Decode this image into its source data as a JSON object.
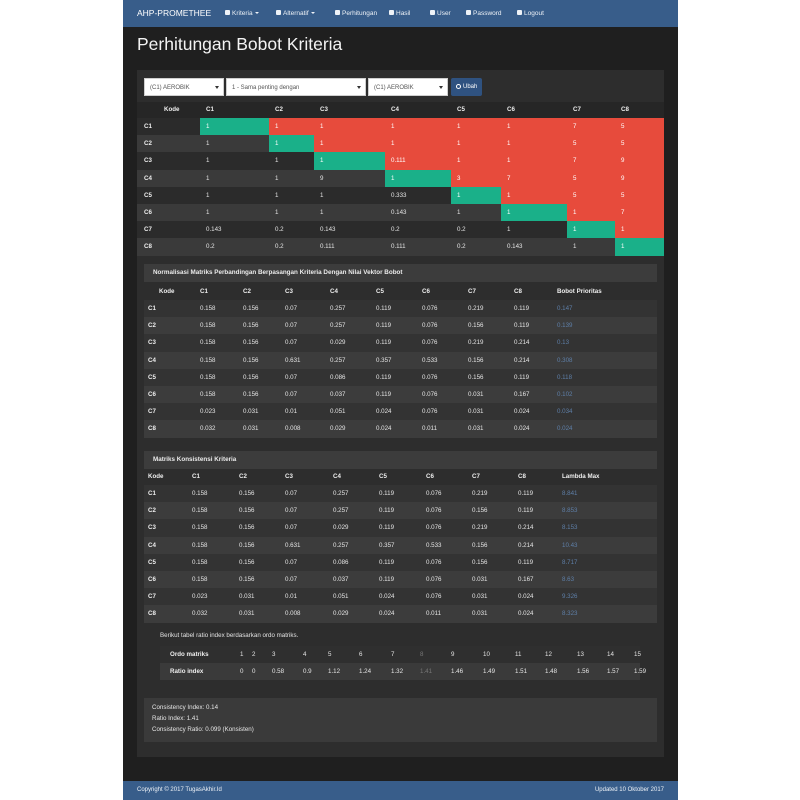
{
  "navbar": {
    "brand": "AHP-PROMETHEE",
    "items": [
      {
        "label": "Kriteria",
        "icon": "grid-icon",
        "dropdown": true
      },
      {
        "label": "Alternatif",
        "icon": "user-icon",
        "dropdown": true
      },
      {
        "label": "Perhitungan",
        "icon": "list-icon",
        "dropdown": false
      },
      {
        "label": "Hasil",
        "icon": "bar-chart-icon",
        "dropdown": false
      },
      {
        "label": "User",
        "icon": "user-icon",
        "dropdown": false
      },
      {
        "label": "Password",
        "icon": "lock-icon",
        "dropdown": false
      },
      {
        "label": "Logout",
        "icon": "logout-icon",
        "dropdown": false
      }
    ]
  },
  "page": {
    "title": "Perhitungan Bobot Kriteria"
  },
  "form": {
    "select1": "(C1) AEROBIK",
    "select2": "1 - Sama penting dengan",
    "select3": "(C1) AEROBIK",
    "submit": "Ubah"
  },
  "colors": {
    "green": "#1ab089",
    "red": "#e74b3c",
    "navbar": "#385d8a",
    "link_blue": "#5e7fa8"
  },
  "comparison": {
    "headers": [
      "Kode",
      "C1",
      "C2",
      "C3",
      "C4",
      "C5",
      "C6",
      "C7",
      "C8"
    ],
    "rows": [
      [
        "C1",
        "1",
        "1",
        "1",
        "1",
        "1",
        "1",
        "7",
        "5"
      ],
      [
        "C2",
        "1",
        "1",
        "1",
        "1",
        "1",
        "1",
        "5",
        "5"
      ],
      [
        "C3",
        "1",
        "1",
        "1",
        "0.111",
        "1",
        "1",
        "7",
        "9"
      ],
      [
        "C4",
        "1",
        "1",
        "9",
        "1",
        "3",
        "7",
        "5",
        "9"
      ],
      [
        "C5",
        "1",
        "1",
        "1",
        "0.333",
        "1",
        "1",
        "5",
        "5"
      ],
      [
        "C6",
        "1",
        "1",
        "1",
        "0.143",
        "1",
        "1",
        "1",
        "7"
      ],
      [
        "C7",
        "0.143",
        "0.2",
        "0.143",
        "0.2",
        "0.2",
        "1",
        "1",
        "1"
      ],
      [
        "C8",
        "0.2",
        "0.2",
        "0.111",
        "0.111",
        "0.2",
        "0.143",
        "1",
        "1"
      ]
    ]
  },
  "normalization": {
    "title": "Normalisasi Matriks Perbandingan Berpasangan Kriteria Dengan Nilai Vektor Bobot",
    "headers": [
      "Kode",
      "C1",
      "C2",
      "C3",
      "C4",
      "C5",
      "C6",
      "C7",
      "C8",
      "Bobot Prioritas"
    ],
    "rows": [
      [
        "C1",
        "0.158",
        "0.156",
        "0.07",
        "0.257",
        "0.119",
        "0.076",
        "0.219",
        "0.119",
        "0.147"
      ],
      [
        "C2",
        "0.158",
        "0.156",
        "0.07",
        "0.257",
        "0.119",
        "0.076",
        "0.156",
        "0.119",
        "0.139"
      ],
      [
        "C3",
        "0.158",
        "0.156",
        "0.07",
        "0.029",
        "0.119",
        "0.076",
        "0.219",
        "0.214",
        "0.13"
      ],
      [
        "C4",
        "0.158",
        "0.156",
        "0.631",
        "0.257",
        "0.357",
        "0.533",
        "0.156",
        "0.214",
        "0.308"
      ],
      [
        "C5",
        "0.158",
        "0.156",
        "0.07",
        "0.086",
        "0.119",
        "0.076",
        "0.156",
        "0.119",
        "0.118"
      ],
      [
        "C6",
        "0.158",
        "0.156",
        "0.07",
        "0.037",
        "0.119",
        "0.076",
        "0.031",
        "0.167",
        "0.102"
      ],
      [
        "C7",
        "0.023",
        "0.031",
        "0.01",
        "0.051",
        "0.024",
        "0.076",
        "0.031",
        "0.024",
        "0.034"
      ],
      [
        "C8",
        "0.032",
        "0.031",
        "0.008",
        "0.029",
        "0.024",
        "0.011",
        "0.031",
        "0.024",
        "0.024"
      ]
    ]
  },
  "consistency": {
    "title": "Matriks Konsistensi Kriteria",
    "headers": [
      "Kode",
      "C1",
      "C2",
      "C3",
      "C4",
      "C5",
      "C6",
      "C7",
      "C8",
      "Lambda Max"
    ],
    "rows": [
      [
        "C1",
        "0.158",
        "0.156",
        "0.07",
        "0.257",
        "0.119",
        "0.076",
        "0.219",
        "0.119",
        "8.841"
      ],
      [
        "C2",
        "0.158",
        "0.156",
        "0.07",
        "0.257",
        "0.119",
        "0.076",
        "0.156",
        "0.119",
        "8.853"
      ],
      [
        "C3",
        "0.158",
        "0.156",
        "0.07",
        "0.029",
        "0.119",
        "0.076",
        "0.219",
        "0.214",
        "8.153"
      ],
      [
        "C4",
        "0.158",
        "0.156",
        "0.631",
        "0.257",
        "0.357",
        "0.533",
        "0.156",
        "0.214",
        "10.43"
      ],
      [
        "C5",
        "0.158",
        "0.156",
        "0.07",
        "0.086",
        "0.119",
        "0.076",
        "0.156",
        "0.119",
        "8.717"
      ],
      [
        "C6",
        "0.158",
        "0.156",
        "0.07",
        "0.037",
        "0.119",
        "0.076",
        "0.031",
        "0.167",
        "8.63"
      ],
      [
        "C7",
        "0.023",
        "0.031",
        "0.01",
        "0.051",
        "0.024",
        "0.076",
        "0.031",
        "0.024",
        "9.326"
      ],
      [
        "C8",
        "0.032",
        "0.031",
        "0.008",
        "0.029",
        "0.024",
        "0.011",
        "0.031",
        "0.024",
        "8.323"
      ]
    ],
    "ratio_note": "Berikut tabel ratio index berdasarkan ordo matriks.",
    "ratio": {
      "row1_label": "Ordo matriks",
      "row2_label": "Ratio index",
      "ordo": [
        "1",
        "2",
        "3",
        "4",
        "5",
        "6",
        "7",
        "8",
        "9",
        "10",
        "11",
        "12",
        "13",
        "14",
        "15"
      ],
      "index": [
        "0",
        "0",
        "0.58",
        "0.9",
        "1.12",
        "1.24",
        "1.32",
        "1.41",
        "1.46",
        "1.49",
        "1.51",
        "1.48",
        "1.56",
        "1.57",
        "1.59"
      ]
    }
  },
  "summary": {
    "ci": "Consistency Index: 0.14",
    "ri": "Ratio Index: 1.41",
    "cr": "Consistency Ratio: 0.099 (Konsisten)"
  },
  "footer": {
    "copyright": "Copyright © 2017 TugasAkhir.Id",
    "updated": "Updated 10 Oktober 2017"
  }
}
